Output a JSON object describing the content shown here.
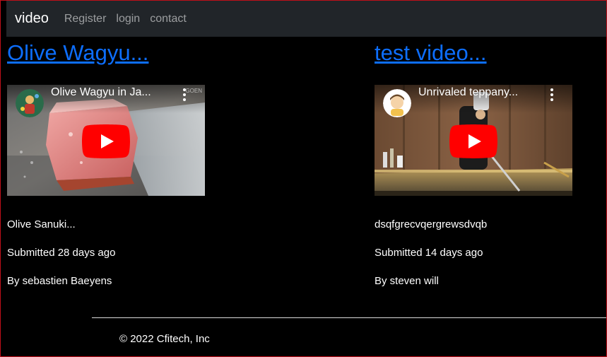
{
  "navbar": {
    "brand": "video",
    "links": [
      "Register",
      "login",
      "contact"
    ]
  },
  "videos": [
    {
      "title": "Olive Wagyu...",
      "embed_title": "Olive Wagyu in Ja...",
      "embed_corner": "GOEN",
      "description": "Olive Sanuki...",
      "submitted": "Submitted 28 days ago",
      "author": "By sebastien Baeyens"
    },
    {
      "title": "test video...",
      "embed_title": "Unrivaled teppany...",
      "description": "dsqfgrecvqergrewsdvqb",
      "submitted": "Submitted 14 days ago",
      "author": "By steven will"
    }
  ],
  "footer": {
    "copyright": "© 2022 Cfitech, Inc"
  },
  "colors": {
    "navbar_bg": "#212529",
    "link_blue": "#0d6efd",
    "youtube_red": "#ff0000",
    "frame_border": "#c0101a"
  }
}
